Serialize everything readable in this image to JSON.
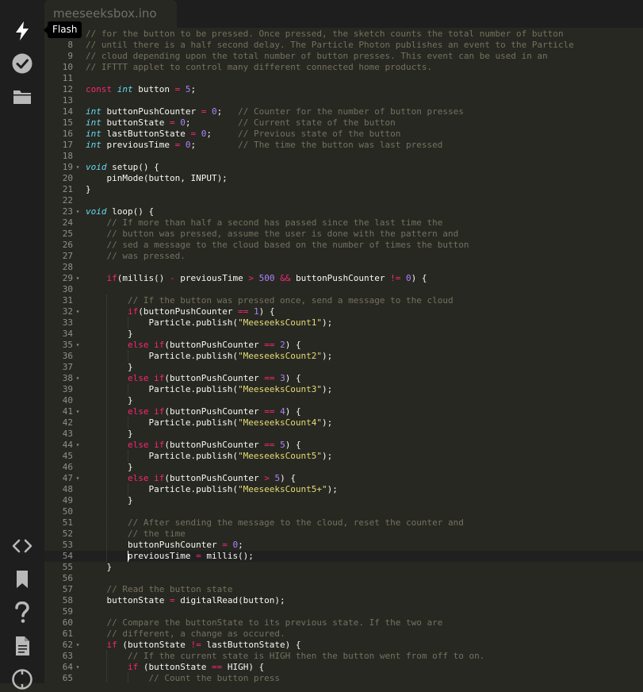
{
  "tab": {
    "filename": "meeseeksbox.ino"
  },
  "sidebar": {
    "tooltip": "Flash",
    "top_icons": [
      "flash-icon",
      "verify-icon",
      "folder-icon"
    ],
    "bottom_icons": [
      "code-icon",
      "bookmark-icon",
      "help-icon",
      "docs-icon",
      "console-icon"
    ]
  },
  "colors": {
    "background": "#272822",
    "sidebar": "#1e1e1e",
    "keyword": "#f92672",
    "type": "#66d9ef",
    "number": "#ae81ff",
    "string": "#e6db74",
    "comment": "#75715e",
    "text": "#f8f8f2"
  },
  "editor": {
    "current_line": 54,
    "lines": [
      {
        "num": "",
        "code": "// for the button to be pressed. Once pressed, the sketch counts the total number of button"
      },
      {
        "num": "8",
        "code": "// until there is a half second delay. The Particle Photon publishes an event to the Particle"
      },
      {
        "num": "9",
        "code": "// cloud depending upon the total number of button presses. This event can be used in an"
      },
      {
        "num": "10",
        "code": "// IFTTT applet to control many different connected home products."
      },
      {
        "num": "11",
        "code": ""
      },
      {
        "num": "12",
        "code": "const int button = 5;"
      },
      {
        "num": "13",
        "code": ""
      },
      {
        "num": "14",
        "code": "int buttonPushCounter = 0;   // Counter for the number of button presses"
      },
      {
        "num": "15",
        "code": "int buttonState = 0;         // Current state of the button"
      },
      {
        "num": "16",
        "code": "int lastButtonState = 0;     // Previous state of the button"
      },
      {
        "num": "17",
        "code": "int previousTime = 0;        // The time the button was last pressed"
      },
      {
        "num": "18",
        "code": ""
      },
      {
        "num": "19",
        "fold": true,
        "code": "void setup() {"
      },
      {
        "num": "20",
        "code": "    pinMode(button, INPUT);"
      },
      {
        "num": "21",
        "code": "}"
      },
      {
        "num": "22",
        "code": ""
      },
      {
        "num": "23",
        "fold": true,
        "code": "void loop() {"
      },
      {
        "num": "24",
        "code": "    // If more than half a second has passed since the last time the"
      },
      {
        "num": "25",
        "code": "    // button was pressed, assume the user is done with the pattern and"
      },
      {
        "num": "26",
        "code": "    // sed a message to the cloud based on the number of times the button"
      },
      {
        "num": "27",
        "code": "    // was pressed."
      },
      {
        "num": "28",
        "code": ""
      },
      {
        "num": "29",
        "fold": true,
        "code": "    if(millis() - previousTime > 500 && buttonPushCounter != 0) {"
      },
      {
        "num": "30",
        "code": ""
      },
      {
        "num": "31",
        "code": "        // If the button was pressed once, send a message to the cloud"
      },
      {
        "num": "32",
        "fold": true,
        "code": "        if(buttonPushCounter == 1) {"
      },
      {
        "num": "33",
        "code": "            Particle.publish(\"MeeseeksCount1\");"
      },
      {
        "num": "34",
        "code": "        }"
      },
      {
        "num": "35",
        "fold": true,
        "code": "        else if(buttonPushCounter == 2) {"
      },
      {
        "num": "36",
        "code": "            Particle.publish(\"MeeseeksCount2\");"
      },
      {
        "num": "37",
        "code": "        }"
      },
      {
        "num": "38",
        "fold": true,
        "code": "        else if(buttonPushCounter == 3) {"
      },
      {
        "num": "39",
        "code": "            Particle.publish(\"MeeseeksCount3\");"
      },
      {
        "num": "40",
        "code": "        }"
      },
      {
        "num": "41",
        "fold": true,
        "code": "        else if(buttonPushCounter == 4) {"
      },
      {
        "num": "42",
        "code": "            Particle.publish(\"MeeseeksCount4\");"
      },
      {
        "num": "43",
        "code": "        }"
      },
      {
        "num": "44",
        "fold": true,
        "code": "        else if(buttonPushCounter == 5) {"
      },
      {
        "num": "45",
        "code": "            Particle.publish(\"MeeseeksCount5\");"
      },
      {
        "num": "46",
        "code": "        }"
      },
      {
        "num": "47",
        "fold": true,
        "code": "        else if(buttonPushCounter > 5) {"
      },
      {
        "num": "48",
        "code": "            Particle.publish(\"MeeseeksCount5+\");"
      },
      {
        "num": "49",
        "code": "        }"
      },
      {
        "num": "50",
        "code": ""
      },
      {
        "num": "51",
        "code": "        // After sending the message to the cloud, reset the counter and"
      },
      {
        "num": "52",
        "code": "        // the time"
      },
      {
        "num": "53",
        "code": "        buttonPushCounter = 0;"
      },
      {
        "num": "54",
        "code": "        previousTime = millis();"
      },
      {
        "num": "55",
        "code": "    }"
      },
      {
        "num": "56",
        "code": ""
      },
      {
        "num": "57",
        "code": "    // Read the button state"
      },
      {
        "num": "58",
        "code": "    buttonState = digitalRead(button);"
      },
      {
        "num": "59",
        "code": ""
      },
      {
        "num": "60",
        "code": "    // Compare the buttonState to its previous state. If the two are"
      },
      {
        "num": "61",
        "code": "    // different, a change as occured."
      },
      {
        "num": "62",
        "fold": true,
        "code": "    if (buttonState != lastButtonState) {"
      },
      {
        "num": "63",
        "code": "        // If the current state is HIGH then the button went from off to on."
      },
      {
        "num": "64",
        "fold": true,
        "code": "        if (buttonState == HIGH) {"
      },
      {
        "num": "65",
        "code": "            // Count the button press"
      }
    ]
  }
}
